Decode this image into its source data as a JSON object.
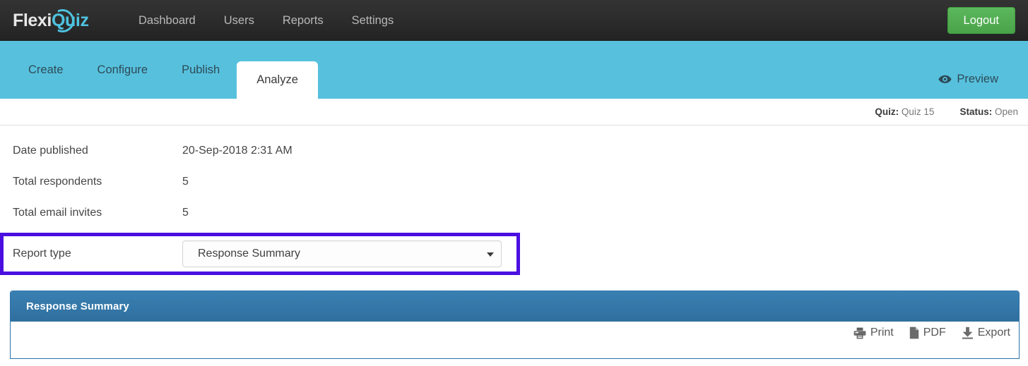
{
  "brand": {
    "name_part1": "Flexi",
    "name_part2": "Quiz",
    "accent_color": "#4ec3e0"
  },
  "topnav": {
    "links": [
      {
        "label": "Dashboard"
      },
      {
        "label": "Users"
      },
      {
        "label": "Reports"
      },
      {
        "label": "Settings"
      }
    ],
    "logout_label": "Logout",
    "logout_color": "#5cb85c",
    "background_color": "#2b2b2b"
  },
  "tabbar": {
    "background_color": "#57c1dd",
    "tabs": [
      {
        "label": "Create",
        "active": false
      },
      {
        "label": "Configure",
        "active": false
      },
      {
        "label": "Publish",
        "active": false
      },
      {
        "label": "Analyze",
        "active": true
      }
    ],
    "preview_label": "Preview",
    "preview_icon": "eye-icon"
  },
  "status_strip": {
    "quiz_label": "Quiz:",
    "quiz_value": "Quiz 15",
    "status_label": "Status:",
    "status_value": "Open"
  },
  "info_rows": [
    {
      "label": "Date published",
      "value": "20-Sep-2018 2:31 AM"
    },
    {
      "label": "Total respondents",
      "value": "5"
    },
    {
      "label": "Total email invites",
      "value": "5"
    }
  ],
  "report_type": {
    "label": "Report type",
    "selected_value": "Response Summary",
    "options": [
      "Response Summary"
    ],
    "highlight_color": "#4a0fe0",
    "dropdown_icon": "chevron-down-icon"
  },
  "panel": {
    "title": "Response Summary",
    "header_color": "#2f6f9e",
    "border_color": "#2d72ab",
    "actions": [
      {
        "label": "Print",
        "icon": "printer-icon"
      },
      {
        "label": "PDF",
        "icon": "file-icon"
      },
      {
        "label": "Export",
        "icon": "download-icon"
      }
    ]
  }
}
